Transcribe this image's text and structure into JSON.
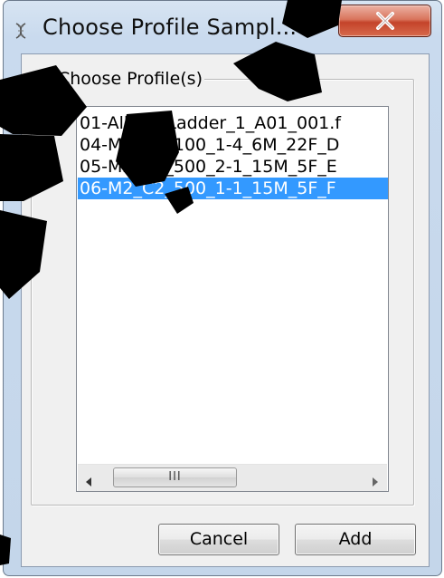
{
  "window": {
    "title": "Choose Profile Sampl...",
    "icon": "dna-icon",
    "close_icon": "close-x-icon",
    "close_color": "#c4432a"
  },
  "group": {
    "label": "Choose Profile(s)"
  },
  "profile_list": {
    "items": [
      "01-Allelic_Ladder_1_A01_001.f",
      "04-M1_C4_100_1-4_6M_22F_D",
      "05-M2_C2_500_2-1_15M_5F_E",
      "06-M2_C2_500_1-1_15M_5F_F"
    ],
    "selected_index": 3,
    "selection_color": "#3399ff",
    "scrollbar_grip": "III"
  },
  "buttons": {
    "cancel": "Cancel",
    "add": "Add"
  }
}
